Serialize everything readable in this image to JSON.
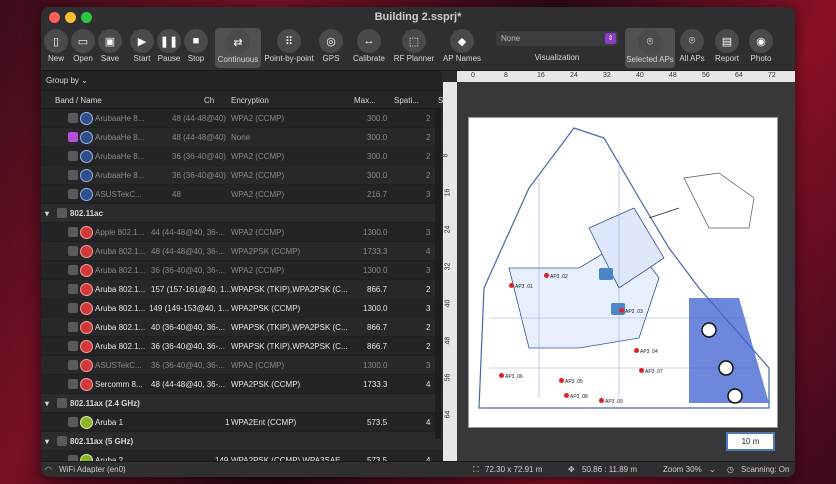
{
  "window": {
    "title": "Building 2.ssprj*"
  },
  "toolbar": {
    "new": "New",
    "open": "Open",
    "save": "Save",
    "start": "Start",
    "pause": "Pause",
    "stop": "Stop",
    "continuous": "Continuous",
    "point_by_point": "Point-by-point",
    "gps": "GPS",
    "calibrate": "Calibrate",
    "rf_planner": "RF Planner",
    "ap_names": "AP Names",
    "visualization_value": "None",
    "visualization_label": "Visualization",
    "selected_aps": "Selected APs",
    "all_aps": "All APs",
    "report": "Report",
    "photo": "Photo"
  },
  "list": {
    "group_by": "Group by",
    "columns": {
      "band_name": "Band / Name",
      "ch": "Ch",
      "encryption": "Encryption",
      "max": "Max...",
      "spatial": "Spati...",
      "s": "S"
    },
    "rows_top": [
      {
        "name": "ArubaaHe 8...",
        "ch": "48 (44-48@40)",
        "enc": "WPA2 (CCMP)",
        "max": "300.0",
        "sp": "2"
      },
      {
        "name": "ArubaaHe 8...",
        "ch": "48 (44-48@40)",
        "enc": "None",
        "max": "300.0",
        "sp": "2"
      },
      {
        "name": "ArubaaHe 8...",
        "ch": "36 (36-40@40)",
        "enc": "WPA2 (CCMP)",
        "max": "300.0",
        "sp": "2"
      },
      {
        "name": "ArubaaHe 8...",
        "ch": "36 (36-40@40)",
        "enc": "WPA2 (CCMP)",
        "max": "300.0",
        "sp": "2"
      },
      {
        "name": "ASUSTekC...",
        "ch": "48",
        "enc": "WPA2 (CCMP)",
        "max": "216.7",
        "sp": "3"
      }
    ],
    "group_ac": "802.11ac",
    "rows_ac": [
      {
        "name": "Apple 802.1...",
        "ch": "44 (44-48@40, 36-...",
        "enc": "WPA2 (CCMP)",
        "max": "1300.0",
        "sp": "3"
      },
      {
        "name": "Aruba 802.1...",
        "ch": "48 (44-48@40, 36-...",
        "enc": "WPA2PSK (CCMP)",
        "max": "1733.3",
        "sp": "4"
      },
      {
        "name": "Aruba 802.1...",
        "ch": "36 (36-40@40, 36-...",
        "enc": "WPA2 (CCMP)",
        "max": "1300.0",
        "sp": "3"
      },
      {
        "name": "Aruba 802.1...",
        "ch": "157 (157-161@40, 1...",
        "enc": "WPAPSK (TKIP),WPA2PSK (C...",
        "max": "866.7",
        "sp": "2"
      },
      {
        "name": "Aruba 802.1...",
        "ch": "149 (149-153@40, 1...",
        "enc": "WPA2PSK (CCMP)",
        "max": "1300.0",
        "sp": "3"
      },
      {
        "name": "Aruba 802.1...",
        "ch": "40 (36-40@40, 36-...",
        "enc": "WPAPSK (TKIP),WPA2PSK (C...",
        "max": "866.7",
        "sp": "2"
      },
      {
        "name": "Aruba 802.1...",
        "ch": "36 (36-40@40, 36-...",
        "enc": "WPAPSK (TKIP),WPA2PSK (C...",
        "max": "866.7",
        "sp": "2"
      },
      {
        "name": "ASUSTekC...",
        "ch": "36 (36-40@40, 36-...",
        "enc": "WPA2 (CCMP)",
        "max": "1300.0",
        "sp": "3"
      },
      {
        "name": "Sercomm 8...",
        "ch": "48 (44-48@40, 36-...",
        "enc": "WPA2PSK (CCMP)",
        "max": "1733.3",
        "sp": "4"
      }
    ],
    "group_ax24": "802.11ax (2.4 GHz)",
    "row_ax24": {
      "name": "Aruba 1",
      "ch": "1",
      "enc": "WPA2Ent (CCMP)",
      "max": "573.5",
      "sp": "4"
    },
    "group_ax5": "802.11ax (5 GHz)",
    "row_ax5": {
      "name": "Aruba 2",
      "ch": "149",
      "enc": "WPA2PSK (CCMP),WPA3SAE...",
      "max": "573.5",
      "sp": "4"
    }
  },
  "map": {
    "ruler_h": [
      "0",
      "8",
      "16",
      "24",
      "32",
      "40",
      "48",
      "56",
      "64",
      "72"
    ],
    "ruler_v": [
      "8",
      "16",
      "24",
      "32",
      "40",
      "48",
      "56",
      "64"
    ],
    "ap_labels": [
      "AP3 .01",
      "AP3 .02",
      "AP3 .03",
      "AP3 .04",
      "AP3 .05",
      "AP3 .06",
      "AP3 .07",
      "AP3 .08",
      "AP3 .09"
    ],
    "scale": "10 m"
  },
  "status": {
    "adapter": "WiFi Adapter (en0)",
    "size": "72.30 x 72.91 m",
    "coords": "50.86 : 11.89 m",
    "zoom": "Zoom 30%",
    "scanning": "Scanning: On"
  }
}
